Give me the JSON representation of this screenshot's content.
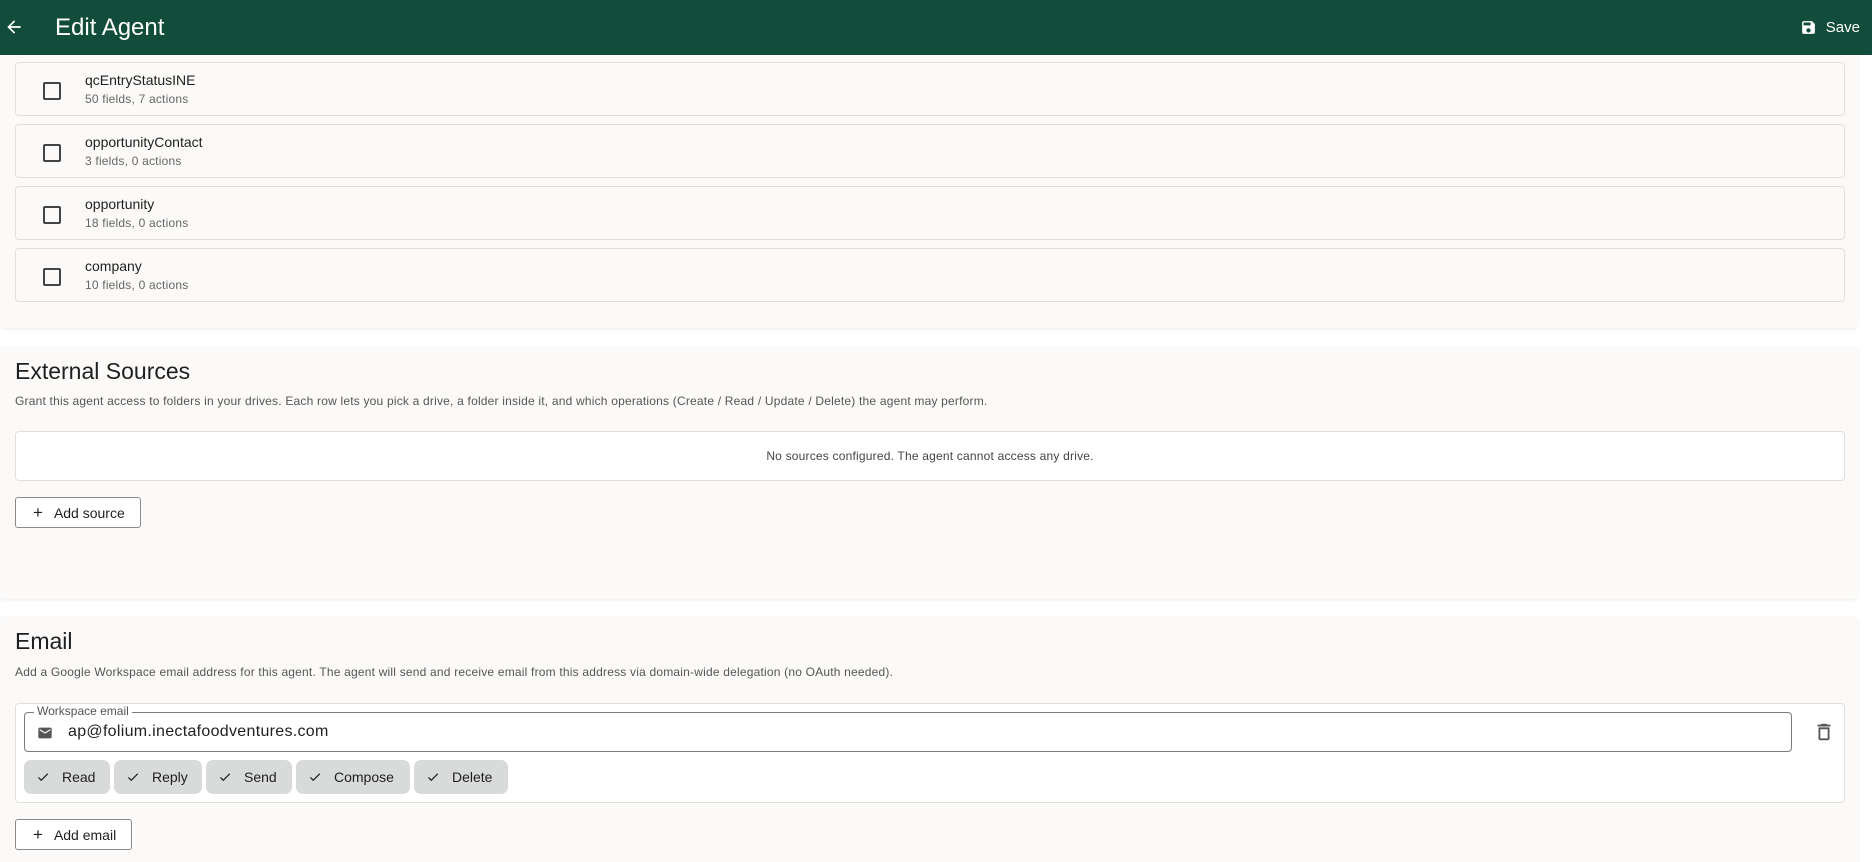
{
  "appbar": {
    "title": "Edit Agent",
    "save_label": "Save",
    "back_icon": "arrow-left-icon",
    "save_icon": "floppy-disk-icon",
    "background": "#124c3a"
  },
  "objects": [
    {
      "name": "qcEntryStatusINE",
      "meta": "50 fields, 7 actions",
      "checked": false
    },
    {
      "name": "opportunityContact",
      "meta": "3 fields, 0 actions",
      "checked": false
    },
    {
      "name": "opportunity",
      "meta": "18 fields, 0 actions",
      "checked": false
    },
    {
      "name": "company",
      "meta": "10 fields, 0 actions",
      "checked": false
    }
  ],
  "external_sources": {
    "title": "External Sources",
    "description": "Grant this agent access to folders in your drives. Each row lets you pick a drive, a folder inside it, and which operations (Create / Read / Update / Delete) the agent may perform.",
    "empty_message": "No sources configured. The agent cannot access any drive.",
    "add_label": "Add source"
  },
  "email": {
    "title": "Email",
    "description": "Add a Google Workspace email address for this agent. The agent will send and receive email from this address via domain-wide delegation (no OAuth needed).",
    "field_label": "Workspace email",
    "field_value": "ap@folium.inectafoodventures.com",
    "permissions": [
      {
        "label": "Read",
        "selected": true
      },
      {
        "label": "Reply",
        "selected": true
      },
      {
        "label": "Send",
        "selected": true
      },
      {
        "label": "Compose",
        "selected": true
      },
      {
        "label": "Delete",
        "selected": true
      }
    ],
    "add_label": "Add email"
  }
}
